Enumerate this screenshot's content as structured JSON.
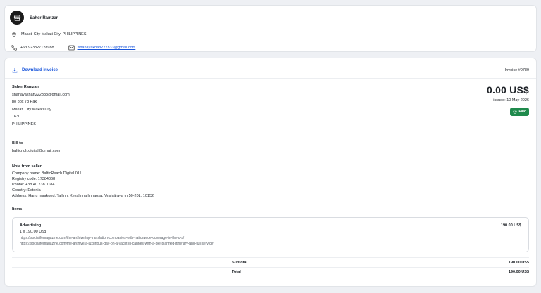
{
  "seller": {
    "name": "Saher Ramzan",
    "location": "Makati City Makati City, PHILIPPINES",
    "phone": "+63 9233271289​88",
    "email": "shanayakhan222333@gmail.com"
  },
  "invoice": {
    "download_label": "Download invoice",
    "number": "Invoice #0789",
    "amount": "0.00 US$",
    "issued": "issued: 10 May 2026",
    "status": "Paid",
    "sender": {
      "name": "Saher Ramzan",
      "email": "shanayakhan222333@gmail.com",
      "address1": "po box 78 Pak",
      "city": "Makati City Makati City",
      "zip": "1630",
      "country": "PHILIPPINES"
    },
    "bill_to": {
      "heading": "Bill to",
      "email": "balticrich.digital@gmail.com"
    },
    "note": {
      "heading": "Note from seller",
      "lines": [
        "Company name: BalticReach Digital OÜ",
        "Registry code: 17384068",
        "Phone: +38 40 738 0184",
        "Country: Estonia",
        "Address: Harju maakond, Tallinn, Kesklinna linnaosa, Vesivärava tn 50-201, 10152"
      ]
    },
    "items_heading": "Items",
    "items": [
      {
        "name": "Advertising",
        "qty": "1 x 190.00 US$",
        "price": "190.00 US$",
        "links": [
          "https://socialifemagazine.com/the-archive/top-translation-companies-with-nationwide-coverage-in-the-u-s/",
          "https://socialifemagazine.com/the-archive/a-luxurious-day-on-a-yacht-in-cannes-with-a-pre-planned-itinerary-and-full-service/"
        ]
      }
    ],
    "subtotal_label": "Subtotal",
    "subtotal": "190.00 US$",
    "total_label": "Total",
    "total": "190.00 US$"
  },
  "colors": {
    "accent": "#1a56db",
    "paid": "#1f8a4c",
    "background": "#eef0f4"
  }
}
